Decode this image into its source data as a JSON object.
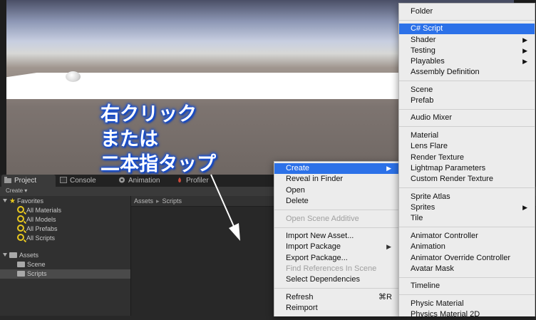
{
  "annotation": {
    "lines": [
      "右クリック",
      "または",
      "二本指タップ"
    ]
  },
  "tabs": [
    {
      "label": "Project",
      "icon": "folder-icon"
    },
    {
      "label": "Console",
      "icon": "console-icon"
    },
    {
      "label": "Animation",
      "icon": "animation-icon"
    },
    {
      "label": "Profiler",
      "icon": "profiler-icon"
    }
  ],
  "toolbar": {
    "create_label": "Create ▾"
  },
  "favorites": {
    "label": "Favorites",
    "items": [
      "All Materials",
      "All Models",
      "All Prefabs",
      "All Scripts"
    ]
  },
  "assets": {
    "label": "Assets",
    "items": [
      "Scene",
      "Scripts"
    ]
  },
  "breadcrumb": {
    "root": "Assets",
    "separator": "▸",
    "current": "Scripts"
  },
  "context_menu": {
    "create": "Create",
    "reveal": "Reveal in Finder",
    "open": "Open",
    "delete": "Delete",
    "open_scene_additive": "Open Scene Additive",
    "import_new_asset": "Import New Asset...",
    "import_package": "Import Package",
    "export_package": "Export Package...",
    "find_references": "Find References In Scene",
    "select_dependencies": "Select Dependencies",
    "refresh": "Refresh",
    "refresh_shortcut": "⌘R",
    "reimport": "Reimport",
    "submenu_arrow": "▶"
  },
  "create_submenu": {
    "folder": "Folder",
    "csharp": "C# Script",
    "shader": "Shader",
    "testing": "Testing",
    "playables": "Playables",
    "assembly": "Assembly Definition",
    "scene": "Scene",
    "prefab": "Prefab",
    "audio_mixer": "Audio Mixer",
    "material": "Material",
    "lens_flare": "Lens Flare",
    "render_texture": "Render Texture",
    "lightmap": "Lightmap Parameters",
    "custom_render_texture": "Custom Render Texture",
    "sprite_atlas": "Sprite Atlas",
    "sprites": "Sprites",
    "tile": "Tile",
    "animator_controller": "Animator Controller",
    "animation": "Animation",
    "animator_override": "Animator Override Controller",
    "avatar_mask": "Avatar Mask",
    "timeline": "Timeline",
    "physic_material": "Physic Material",
    "physics_material_2d": "Physics Material 2D"
  },
  "colors": {
    "highlight": "#2c71e8",
    "annotation_glow": "#1650d8",
    "favorites_icon": "#e8c820"
  }
}
